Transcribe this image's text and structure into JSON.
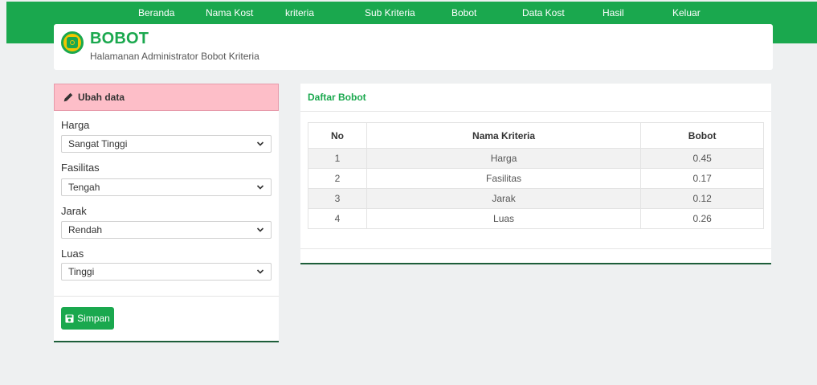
{
  "nav": {
    "items": [
      "Beranda",
      "Nama Kost",
      "kriteria",
      "Sub Kriteria",
      "Bobot",
      "Data Kost",
      "Hasil",
      "Keluar"
    ]
  },
  "header": {
    "title": "BOBOT",
    "subtitle": "Halamanan Administrator Bobot Kriteria",
    "logo_icon": "scale-icon"
  },
  "form": {
    "title": "Ubah data",
    "title_icon": "pencil-icon",
    "fields": [
      {
        "label": "Harga",
        "value": "Sangat Tinggi"
      },
      {
        "label": "Fasilitas",
        "value": "Tengah"
      },
      {
        "label": "Jarak",
        "value": "Rendah"
      },
      {
        "label": "Luas",
        "value": "Tinggi"
      }
    ],
    "save_label": "Simpan",
    "save_icon": "save-icon"
  },
  "table": {
    "title": "Daftar Bobot",
    "headers": [
      "No",
      "Nama Kriteria",
      "Bobot"
    ],
    "rows": [
      [
        "1",
        "Harga",
        "0.45"
      ],
      [
        "2",
        "Fasilitas",
        "0.17"
      ],
      [
        "3",
        "Jarak",
        "0.12"
      ],
      [
        "4",
        "Luas",
        "0.26"
      ]
    ]
  },
  "colors": {
    "brand_green": "#1aa84e",
    "form_header_pink": "#fdbec8",
    "accent_yellow": "#f2c500"
  }
}
